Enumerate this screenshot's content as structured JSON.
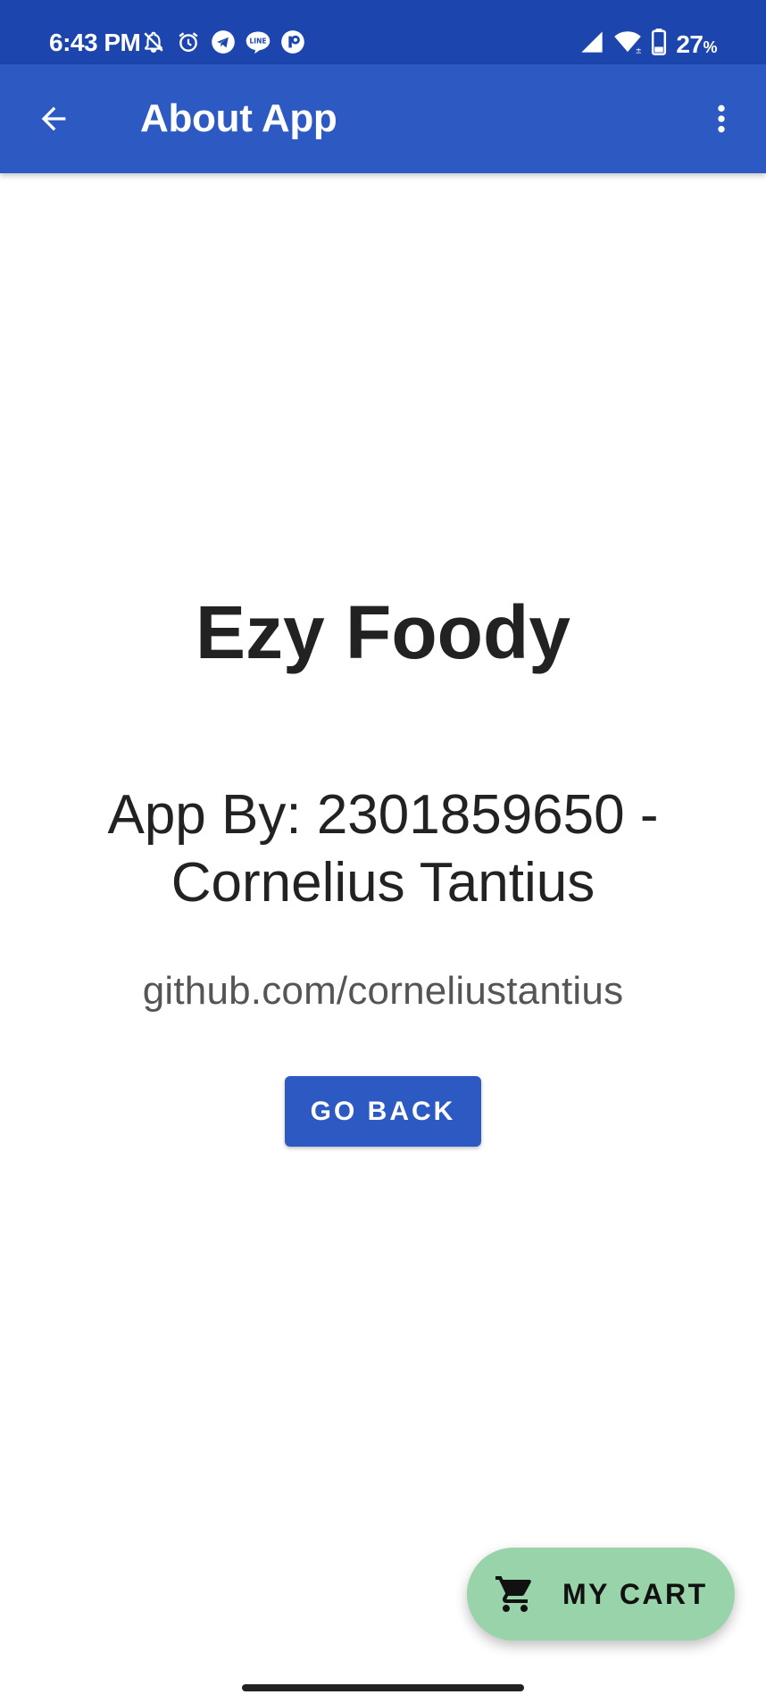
{
  "status_bar": {
    "time": "6:43 PM",
    "battery_percent": "27",
    "battery_suffix": "%",
    "left_icons": [
      "bell-off-icon",
      "alarm-icon",
      "telegram-icon",
      "line-icon",
      "app-notification-icon"
    ],
    "right_icons": [
      "cell-signal-icon",
      "wifi-icon",
      "battery-icon"
    ]
  },
  "app_bar": {
    "title": "About App",
    "back_icon": "arrow-back-icon",
    "menu_icon": "more-vert-icon"
  },
  "content": {
    "app_name": "Ezy Foody",
    "author_line1": "App By: 2301859650 -",
    "author_line2": "Cornelius Tantius",
    "link": "github.com/corneliustantius",
    "go_back_label": "GO BACK"
  },
  "fab": {
    "icon": "shopping-cart-icon",
    "label": "MY CART"
  },
  "colors": {
    "status_bar": "#1c46ad",
    "app_bar": "#2d5ac2",
    "button": "#2d5ac2",
    "fab": "#98d3a9",
    "text_primary": "#222222",
    "text_secondary": "#555555"
  }
}
